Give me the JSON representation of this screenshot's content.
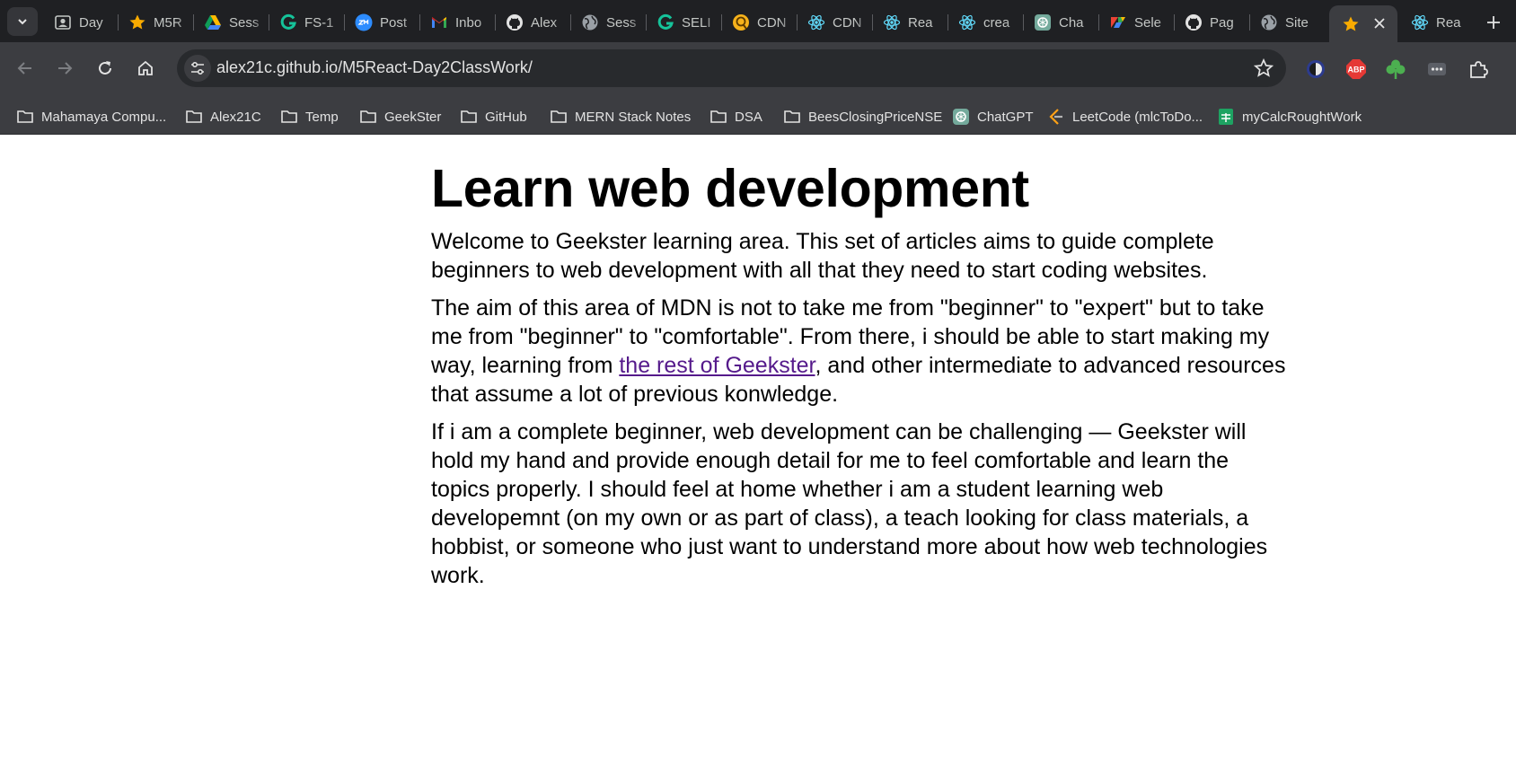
{
  "browser": {
    "tabs": [
      {
        "title": "Day",
        "icon": "account-box-icon"
      },
      {
        "title": "M5R",
        "icon": "star-icon"
      },
      {
        "title": "Sess",
        "icon": "google-drive-icon"
      },
      {
        "title": "FS-1",
        "icon": "grammarly-icon"
      },
      {
        "title": "Post",
        "icon": "zoom-icon"
      },
      {
        "title": "Inbo",
        "icon": "gmail-icon"
      },
      {
        "title": "Alex",
        "icon": "github-icon"
      },
      {
        "title": "Sess",
        "icon": "globe-icon"
      },
      {
        "title": "SELI",
        "icon": "grammarly-icon"
      },
      {
        "title": "CDN",
        "icon": "emoji-icon"
      },
      {
        "title": "CDN",
        "icon": "react-icon"
      },
      {
        "title": "Rea",
        "icon": "react-icon"
      },
      {
        "title": "crea",
        "icon": "react-icon"
      },
      {
        "title": "Cha",
        "icon": "chatgpt-icon"
      },
      {
        "title": "Sele",
        "icon": "selenium-icon"
      },
      {
        "title": "Pag",
        "icon": "github-icon"
      },
      {
        "title": "Site",
        "icon": "globe-icon"
      },
      {
        "title": "",
        "icon": "star-icon",
        "active": true
      },
      {
        "title": "Rea",
        "icon": "react-icon"
      }
    ],
    "url": "alex21c.github.io/M5React-Day2ClassWork/",
    "bookmarks": [
      {
        "label": "Mahamaya Compu...",
        "icon": "folder-icon"
      },
      {
        "label": "Alex21C",
        "icon": "folder-icon"
      },
      {
        "label": "Temp",
        "icon": "folder-icon"
      },
      {
        "label": "GeekSter",
        "icon": "folder-icon"
      },
      {
        "label": "GitHub",
        "icon": "folder-icon"
      },
      {
        "label": "MERN Stack Notes",
        "icon": "folder-icon"
      },
      {
        "label": "DSA",
        "icon": "folder-icon"
      },
      {
        "label": "BeesClosingPriceNSE",
        "icon": "folder-icon"
      },
      {
        "label": "ChatGPT",
        "icon": "chatgpt-icon"
      },
      {
        "label": "LeetCode (mlcToDo...",
        "icon": "leetcode-icon"
      },
      {
        "label": "myCalcRoughtWork",
        "icon": "sheets-icon"
      }
    ],
    "extensions": [
      {
        "name": "dark-reader-icon"
      },
      {
        "name": "adblock-plus-icon",
        "text": "ABP"
      },
      {
        "name": "clover-icon"
      },
      {
        "name": "extension-menu-icon"
      },
      {
        "name": "puzzle-icon"
      }
    ],
    "colors": {
      "chrome_dark": "#1f2023",
      "toolbar": "#3c3d41",
      "omnibox": "#282a2d",
      "active_star": "#f9ab00"
    }
  },
  "page": {
    "title": "Learn web development",
    "para1": "Welcome to Geekster learning area. This set of articles aims to guide complete beginners to web development with all that they need to start coding websites.",
    "para2_before": "The aim of this area of MDN is not to take me from \"beginner\" to \"expert\" but to take me from \"beginner\" to \"comfortable\". From there, i should be able to start making my way, learning from ",
    "para2_link": "the rest of Geekster",
    "para2_after": ", and other intermediate to advanced resources that assume a lot of previous konwledge.",
    "para3": "If i am a complete beginner, web development can be challenging — Geekster will hold my hand and provide enough detail for me to feel comfortable and learn the topics properly. I should feel at home whether i am a student learning web developemnt (on my own or as part of class), a teach looking for class materials, a hobbist, or someone who just want to understand more about how web technologies work.",
    "link_color": "#551a8b"
  }
}
